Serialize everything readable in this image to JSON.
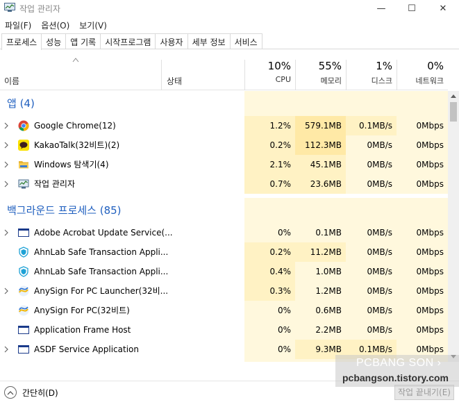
{
  "window": {
    "title": "작업 관리자",
    "min_glyph": "—",
    "max_glyph": "☐",
    "close_glyph": "✕"
  },
  "menu": [
    "파일(F)",
    "옵션(O)",
    "보기(V)"
  ],
  "tabs": [
    "프로세스",
    "성능",
    "앱 기록",
    "시작프로그램",
    "사용자",
    "세부 정보",
    "서비스"
  ],
  "active_tab": "프로세스",
  "header": {
    "name": "이름",
    "status": "상태",
    "cpu_pct": "10%",
    "cpu_label": "CPU",
    "mem_pct": "55%",
    "mem_label": "메모리",
    "disk_pct": "1%",
    "disk_label": "디스크",
    "net_pct": "0%",
    "net_label": "네트워크"
  },
  "groups": {
    "apps": "앱 (4)",
    "background": "백그라운드 프로세스 (85)"
  },
  "apps": [
    {
      "name": "Google Chrome(12)",
      "icon": "chrome-icon",
      "expand": true,
      "cpu": "1.2%",
      "mem": "579.1MB",
      "disk": "0.1MB/s",
      "net": "0Mbps"
    },
    {
      "name": "KakaoTalk(32비트)(2)",
      "icon": "kakaotalk-icon",
      "expand": true,
      "cpu": "0.2%",
      "mem": "112.3MB",
      "disk": "0MB/s",
      "net": "0Mbps"
    },
    {
      "name": "Windows 탐색기(4)",
      "icon": "folder-icon",
      "expand": true,
      "cpu": "2.1%",
      "mem": "45.1MB",
      "disk": "0MB/s",
      "net": "0Mbps"
    },
    {
      "name": "작업 관리자",
      "icon": "taskmgr-icon",
      "expand": true,
      "cpu": "0.7%",
      "mem": "23.6MB",
      "disk": "0MB/s",
      "net": "0Mbps"
    }
  ],
  "background": [
    {
      "name": "Adobe Acrobat Update Service(...",
      "icon": "app-window-icon",
      "expand": true,
      "cpu": "0%",
      "mem": "0.1MB",
      "disk": "0MB/s",
      "net": "0Mbps"
    },
    {
      "name": "AhnLab Safe Transaction Appli...",
      "icon": "shield-icon",
      "expand": false,
      "cpu": "0.2%",
      "mem": "11.2MB",
      "disk": "0MB/s",
      "net": "0Mbps"
    },
    {
      "name": "AhnLab Safe Transaction Appli...",
      "icon": "shield-icon",
      "expand": false,
      "cpu": "0.4%",
      "mem": "1.0MB",
      "disk": "0MB/s",
      "net": "0Mbps"
    },
    {
      "name": "AnySign For PC Launcher(32비...",
      "icon": "anysign-icon",
      "expand": true,
      "cpu": "0.3%",
      "mem": "1.2MB",
      "disk": "0MB/s",
      "net": "0Mbps"
    },
    {
      "name": "AnySign For PC(32비트)",
      "icon": "anysign-icon",
      "expand": false,
      "cpu": "0%",
      "mem": "0.6MB",
      "disk": "0MB/s",
      "net": "0Mbps"
    },
    {
      "name": "Application Frame Host",
      "icon": "app-window-icon",
      "expand": false,
      "cpu": "0%",
      "mem": "2.2MB",
      "disk": "0MB/s",
      "net": "0Mbps"
    },
    {
      "name": "ASDF Service Application",
      "icon": "app-window-icon",
      "expand": true,
      "cpu": "0%",
      "mem": "9.3MB",
      "disk": "0.1MB/s",
      "net": "0Mbps"
    }
  ],
  "footer": {
    "fewer_details": "간단히(D)",
    "end_task": "작업 끝내기(E)"
  },
  "watermark": {
    "brand": "PCBANG SON",
    "brand_suffix": "›",
    "url": "pcbangson.tistory.com"
  },
  "colors": {
    "heat_light": "#fff8dd",
    "heat_mid": "#fff2c4",
    "heat_strong": "#ffe9a6",
    "group_title": "#1f5fbf"
  }
}
